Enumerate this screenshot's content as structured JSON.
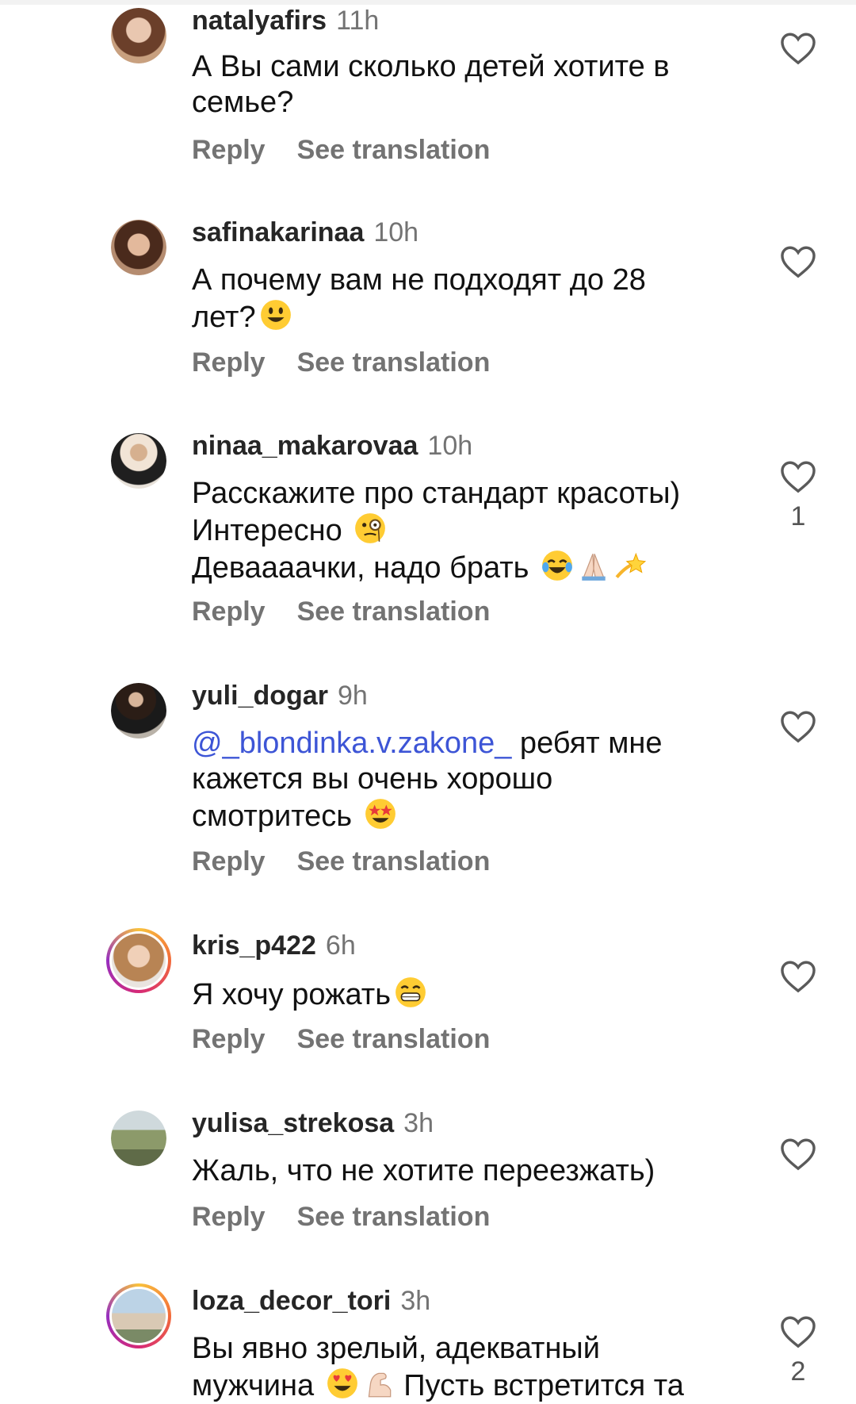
{
  "comments": [
    {
      "username": "natalyafirs",
      "time": "11h",
      "lines": [
        "А Вы сами сколько детей хотите в",
        "семье?"
      ],
      "reply": "Reply",
      "translation": "See translation",
      "likes": ""
    },
    {
      "username": "safinakarinaa",
      "time": "10h",
      "lines": [
        "А почему вам не подходят до 28",
        "лет?"
      ],
      "reply": "Reply",
      "translation": "See translation",
      "likes": ""
    },
    {
      "username": "ninaa_makarovaa",
      "time": "10h",
      "lines": [
        "Расскажите про стандарт красоты)",
        "Интересно ",
        "Деваааачки, надо брать "
      ],
      "reply": "Reply",
      "translation": "See translation",
      "likes": "1"
    },
    {
      "username": "yuli_dogar",
      "time": "9h",
      "mention": "@_blondinka.v.zakone_",
      "lines": [
        " ребят мне",
        "кажется вы очень хорошо",
        "смотритесь "
      ],
      "reply": "Reply",
      "translation": "See translation",
      "likes": ""
    },
    {
      "username": "kris_p422",
      "time": "6h",
      "lines": [
        "Я хочу рожать"
      ],
      "reply": "Reply",
      "translation": "See translation",
      "likes": ""
    },
    {
      "username": "yulisa_strekosa",
      "time": "3h",
      "lines": [
        "Жаль, что не хотите переезжать)"
      ],
      "reply": "Reply",
      "translation": "See translation",
      "likes": ""
    },
    {
      "username": "loza_decor_tori",
      "time": "3h",
      "lines": [
        "Вы явно зрелый, адекватный",
        "мужчина ",
        " Пусть встретится та"
      ],
      "likes": "2"
    }
  ],
  "icons": {
    "like": "heart-outline-icon",
    "emoji": [
      "smiley-emoji",
      "monocle-face-emoji",
      "tears-of-joy-emoji",
      "folded-hands-emoji",
      "dizzy-emoji",
      "star-struck-emoji",
      "grinning-emoji",
      "heart-eyes-emoji",
      "flexed-biceps-emoji"
    ]
  },
  "colors": {
    "username": "#262626",
    "meta": "#737373",
    "mention": "#3d55d6"
  }
}
